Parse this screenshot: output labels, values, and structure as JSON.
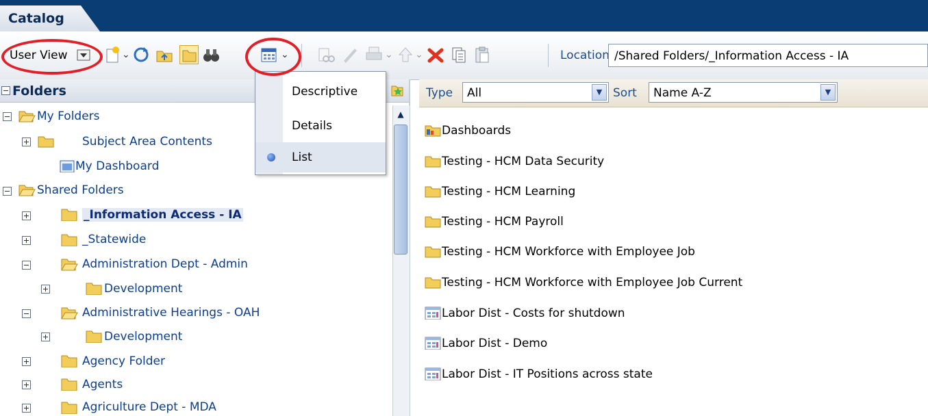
{
  "header": {
    "tab_label": "Catalog"
  },
  "toolbar": {
    "user_view_label": "User View",
    "location_label": "Location",
    "location_value": "/Shared Folders/_Information Access - IA",
    "icons": [
      "new-icon",
      "refresh-icon",
      "folder-up-icon",
      "show-folders-icon",
      "search-binoculars-icon",
      "view-mode-icon",
      "properties-icon",
      "edit-icon",
      "print-icon",
      "upload-icon",
      "delete-icon",
      "copy-icon",
      "paste-icon"
    ]
  },
  "view_menu": {
    "items": [
      {
        "label": "Descriptive"
      },
      {
        "label": "Details"
      },
      {
        "label": "List",
        "selected": true
      }
    ]
  },
  "folders_pane": {
    "title": "Folders",
    "tree": [
      {
        "label": "My Folders",
        "state": "expanded"
      },
      {
        "label": "Subject Area Contents",
        "state": "collapsed"
      },
      {
        "label": "My Dashboard",
        "type": "dashboard"
      },
      {
        "label": "Shared Folders",
        "state": "expanded"
      },
      {
        "label": "_Information Access - IA",
        "state": "collapsed",
        "selected": true
      },
      {
        "label": "_Statewide",
        "state": "collapsed"
      },
      {
        "label": "Administration Dept - Admin",
        "state": "expanded"
      },
      {
        "label": "Development",
        "state": "collapsed"
      },
      {
        "label": "Administrative Hearings - OAH",
        "state": "expanded"
      },
      {
        "label": "Development",
        "state": "collapsed"
      },
      {
        "label": "Agency Folder",
        "state": "collapsed"
      },
      {
        "label": "Agents",
        "state": "collapsed"
      },
      {
        "label": "Agriculture Dept - MDA",
        "state": "collapsed"
      }
    ]
  },
  "filter": {
    "type_label": "Type",
    "type_value": "All",
    "sort_label": "Sort",
    "sort_value": "Name A-Z"
  },
  "items": [
    {
      "label": "Dashboards",
      "type": "dashboards"
    },
    {
      "label": "Testing - HCM Data Security",
      "type": "folder"
    },
    {
      "label": "Testing - HCM Learning",
      "type": "folder"
    },
    {
      "label": "Testing - HCM Payroll",
      "type": "folder"
    },
    {
      "label": "Testing - HCM Workforce with Employee Job",
      "type": "folder"
    },
    {
      "label": "Testing - HCM Workforce with Employee Job Current",
      "type": "folder"
    },
    {
      "label": "Labor Dist - Costs for shutdown",
      "type": "analysis"
    },
    {
      "label": "Labor Dist - Demo",
      "type": "analysis"
    },
    {
      "label": "Labor Dist - IT Positions across state",
      "type": "analysis"
    }
  ],
  "colors": {
    "header": "#0b3d75",
    "link": "#0b3d91",
    "highlight_ring": "#e21f26"
  }
}
